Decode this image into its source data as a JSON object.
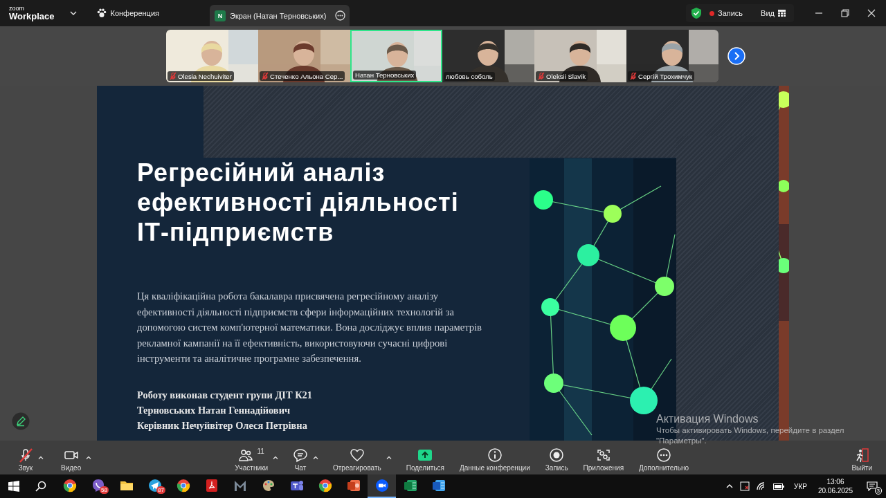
{
  "top_bar": {
    "logo": {
      "line_1": "zoom",
      "line_2": "Workplace"
    },
    "meeting_menu": "Конференция",
    "share_tab": {
      "avatar": "N",
      "title": "Экран (Натан Терновських)"
    },
    "recording": "Запись",
    "view": "Вид"
  },
  "gallery": {
    "participants": [
      {
        "name": "Olesia Nechuiviter",
        "muted": true,
        "selected": false
      },
      {
        "name": "Стеченко Альона Сер...",
        "muted": true,
        "selected": false
      },
      {
        "name": "Натан Терновських",
        "muted": false,
        "selected": true
      },
      {
        "name": "любовь соболь",
        "muted": false,
        "selected": false
      },
      {
        "name": "Oleksii Slavik",
        "muted": true,
        "selected": false
      },
      {
        "name": "Сергій Трохимчук",
        "muted": true,
        "selected": false
      }
    ]
  },
  "slide": {
    "title": "Регресійний аналіз\nефективності діяльності\nІТ-підприємств",
    "description": "Ця кваліфікаційна робота бакалавра присвячена регресійному аналізу\nефективності діяльності підприємств сфери інформаційних технологій за\nдопомогою систем комп'ютерної математики. Вона досліджує вплив параметрів\nрекламної кампанії на її ефективність, використовуючи сучасні цифрові\nінструменти та аналітичне програмне забезпечення.",
    "credits": [
      "Роботу виконав студент групи ДІТ К21",
      "Терновських Натан Геннадійович",
      "Керівник Нечуйвітер Олеся Петрівна"
    ]
  },
  "toolbar": {
    "items": [
      {
        "kind": "audio",
        "label": "Звук",
        "muted": true,
        "caret": true
      },
      {
        "kind": "video",
        "label": "Видео",
        "muted": false,
        "caret": true
      },
      {
        "kind": "participants",
        "label": "Участники",
        "count": "11",
        "caret": true
      },
      {
        "kind": "chat",
        "label": "Чат",
        "caret": true
      },
      {
        "kind": "react",
        "label": "Отреагировать",
        "caret": true
      },
      {
        "kind": "share",
        "label": "Поделиться",
        "caret": false
      },
      {
        "kind": "info",
        "label": "Данные конференции",
        "caret": false
      },
      {
        "kind": "record",
        "label": "Запись",
        "caret": false
      },
      {
        "kind": "apps",
        "label": "Приложения",
        "caret": false
      },
      {
        "kind": "more",
        "label": "Дополнительно",
        "caret": false
      },
      {
        "kind": "leave",
        "label": "Выйти",
        "caret": false
      }
    ]
  },
  "taskbar": {
    "apps": [
      {
        "kind": "browser",
        "selected": false
      },
      {
        "kind": "messenger",
        "badge": "58",
        "selected": false
      },
      {
        "kind": "folder",
        "selected": false
      },
      {
        "kind": "plane",
        "badge": "87",
        "selected": false
      },
      {
        "kind": "browser",
        "selected": false
      },
      {
        "kind": "pdf",
        "selected": false
      },
      {
        "kind": "mark",
        "selected": false
      },
      {
        "kind": "paint",
        "selected": false
      },
      {
        "kind": "teams",
        "selected": false
      },
      {
        "kind": "browser",
        "selected": false
      },
      {
        "kind": "slides",
        "selected": false
      },
      {
        "kind": "video",
        "selected": true
      },
      {
        "kind": "sheet",
        "selected": false
      },
      {
        "kind": "doc",
        "selected": false
      }
    ],
    "tray": {
      "language": "УКР",
      "time": "13:06",
      "date": "20.06.2025",
      "notifications": "3"
    }
  },
  "activation_notice": {
    "title": "Активация Windows",
    "lines": [
      "Чтобы активировать Windows, перейдите в раздел",
      "\"Параметры\"."
    ]
  }
}
